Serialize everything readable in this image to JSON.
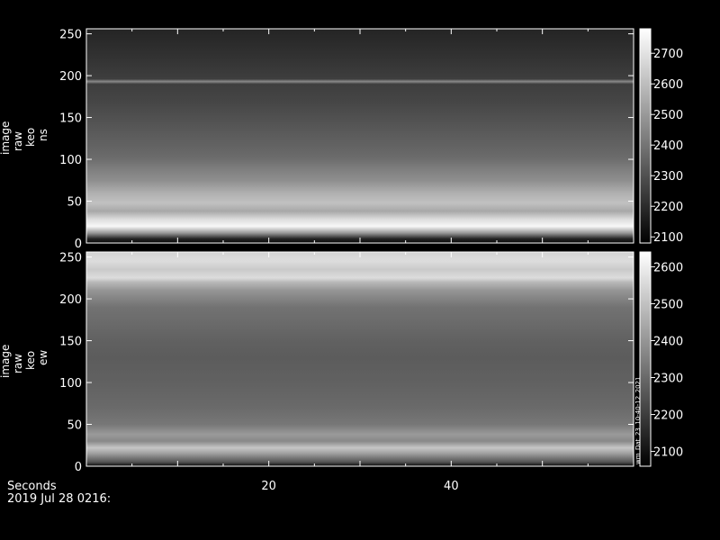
{
  "chart_data": [
    {
      "type": "heatmap",
      "ylabel": [
        "image",
        "raw",
        "keo",
        "ns"
      ],
      "ylim": [
        0,
        256
      ],
      "xlim": [
        0,
        60
      ],
      "yticks": [
        0,
        50,
        100,
        150,
        200,
        250
      ],
      "colorbar": {
        "range": [
          2080,
          2780
        ],
        "ticks": [
          2100,
          2200,
          2300,
          2400,
          2500,
          2600,
          2700
        ]
      },
      "profile": [
        [
          0,
          2105
        ],
        [
          5,
          2180
        ],
        [
          12,
          2500
        ],
        [
          20,
          2760
        ],
        [
          28,
          2690
        ],
        [
          38,
          2540
        ],
        [
          48,
          2610
        ],
        [
          60,
          2560
        ],
        [
          75,
          2470
        ],
        [
          90,
          2420
        ],
        [
          100,
          2380
        ],
        [
          110,
          2360
        ],
        [
          130,
          2330
        ],
        [
          150,
          2300
        ],
        [
          170,
          2270
        ],
        [
          190,
          2250
        ],
        [
          193,
          2460
        ],
        [
          196,
          2250
        ],
        [
          220,
          2220
        ],
        [
          256,
          2180
        ]
      ],
      "cross_time_variation": "slightly brighter near x=10 and x=40-55, darker near x=20"
    },
    {
      "type": "heatmap",
      "ylabel": [
        "image",
        "raw",
        "keo",
        "ew"
      ],
      "ylim": [
        0,
        256
      ],
      "xlim": [
        0,
        60
      ],
      "yticks": [
        0,
        50,
        100,
        150,
        200,
        250
      ],
      "colorbar": {
        "range": [
          2060,
          2640
        ],
        "ticks": [
          2100,
          2200,
          2300,
          2400,
          2500,
          2600
        ]
      },
      "side_label": "wm_Dat_23_10-40-12_2021",
      "profile": [
        [
          0,
          2080
        ],
        [
          5,
          2250
        ],
        [
          15,
          2420
        ],
        [
          22,
          2510
        ],
        [
          30,
          2370
        ],
        [
          38,
          2410
        ],
        [
          50,
          2330
        ],
        [
          70,
          2300
        ],
        [
          100,
          2280
        ],
        [
          130,
          2270
        ],
        [
          150,
          2280
        ],
        [
          170,
          2300
        ],
        [
          190,
          2320
        ],
        [
          210,
          2400
        ],
        [
          220,
          2480
        ],
        [
          225,
          2560
        ],
        [
          235,
          2520
        ],
        [
          245,
          2560
        ],
        [
          256,
          2540
        ]
      ],
      "cross_time_variation": "brighter band near y=30 around x=30-45"
    }
  ],
  "xaxis": {
    "label": "Seconds",
    "date": "2019 Jul 28 0216:",
    "ticks": [
      20,
      40
    ]
  }
}
